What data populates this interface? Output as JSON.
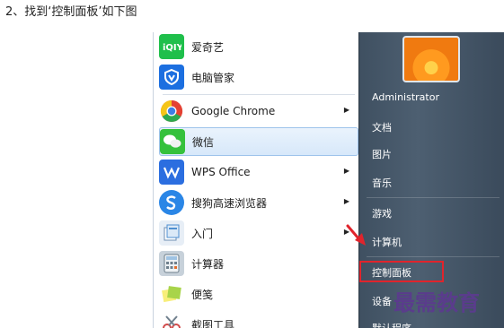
{
  "instruction": "2、找到‘控制面板’如下图",
  "left_items": [
    {
      "label": "爱奇艺",
      "icon": "iqiyi-icon",
      "color": "#1fbf4b",
      "arrow": false
    },
    {
      "label": "电脑管家",
      "icon": "shield-icon",
      "color": "#1c6fe0",
      "arrow": false
    },
    {
      "label": "Google Chrome",
      "icon": "chrome-icon",
      "color": "#e44133",
      "arrow": true
    },
    {
      "label": "微信",
      "icon": "wechat-icon",
      "color": "#35c13c",
      "arrow": false
    },
    {
      "label": "WPS Office",
      "icon": "wps-icon",
      "color": "#2b6ee0",
      "arrow": true
    },
    {
      "label": "搜狗高速浏览器",
      "icon": "sogou-icon",
      "color": "#2a86e6",
      "arrow": true
    },
    {
      "label": "入门",
      "icon": "getting-started-icon",
      "color": "#4f8fd0",
      "arrow": true
    },
    {
      "label": "计算器",
      "icon": "calculator-icon",
      "color": "#7d8e9c",
      "arrow": false
    },
    {
      "label": "便笺",
      "icon": "sticky-notes-icon",
      "color": "#a8d44a",
      "arrow": false
    },
    {
      "label": "截图工具",
      "icon": "snipping-tool-icon",
      "color": "#d24a4a",
      "arrow": false
    }
  ],
  "right_items": [
    {
      "label": "Administrator"
    },
    {
      "label": "文档"
    },
    {
      "label": "图片"
    },
    {
      "label": "音乐"
    },
    {
      "label": "游戏"
    },
    {
      "label": "计算机"
    },
    {
      "label": "控制面板"
    },
    {
      "label": "设备"
    },
    {
      "label": "默认程序"
    }
  ],
  "watermark": "最需教育",
  "accent_red": "#e0242c"
}
